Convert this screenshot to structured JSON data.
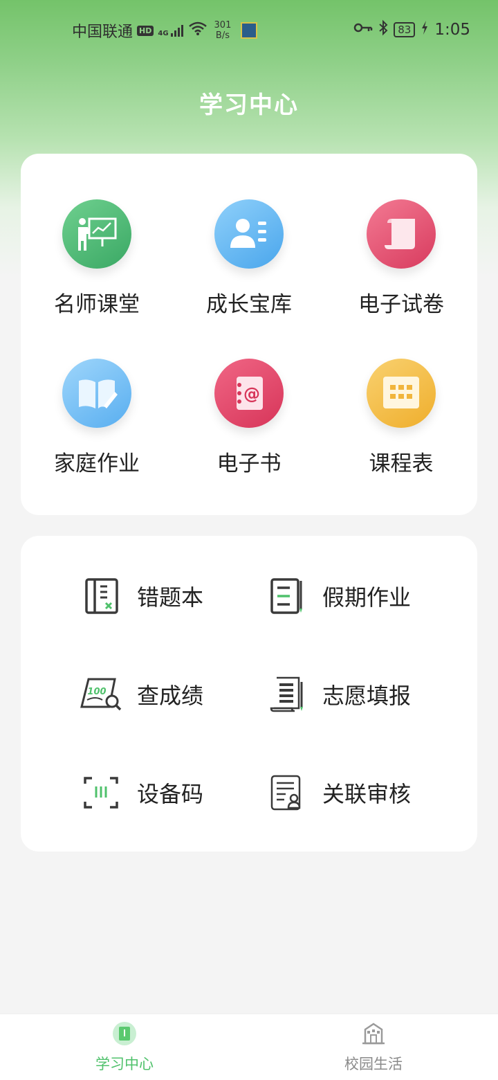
{
  "status_bar": {
    "carrier": "中国联通",
    "hd": "HD",
    "network": "4G",
    "speed_value": "301",
    "speed_unit": "B/s",
    "battery": "83",
    "time": "1:05"
  },
  "page_title": "学习中心",
  "grid_menu": [
    {
      "label": "名师课堂",
      "icon": "teacher-board-icon",
      "color": "#4cbb79"
    },
    {
      "label": "成长宝库",
      "icon": "profile-card-icon",
      "color": "#5fb4f2"
    },
    {
      "label": "电子试卷",
      "icon": "scroll-paper-icon",
      "color": "#e84f72"
    },
    {
      "label": "家庭作业",
      "icon": "open-book-icon",
      "color": "#6fb8f4"
    },
    {
      "label": "电子书",
      "icon": "address-book-icon",
      "color": "#e6476a"
    },
    {
      "label": "课程表",
      "icon": "calendar-grid-icon",
      "color": "#f5be3e"
    }
  ],
  "list_menu": [
    {
      "label": "错题本",
      "icon": "wrong-notebook-icon"
    },
    {
      "label": "假期作业",
      "icon": "holiday-homework-icon"
    },
    {
      "label": "查成绩",
      "icon": "score-search-icon"
    },
    {
      "label": "志愿填报",
      "icon": "application-scroll-icon"
    },
    {
      "label": "设备码",
      "icon": "device-code-icon"
    },
    {
      "label": "关联审核",
      "icon": "link-review-icon"
    }
  ],
  "bottom_nav": [
    {
      "label": "学习中心",
      "active": true
    },
    {
      "label": "校园生活",
      "active": false
    }
  ],
  "colors": {
    "accent": "#4fc16b",
    "inactive": "#8a8a8a"
  }
}
